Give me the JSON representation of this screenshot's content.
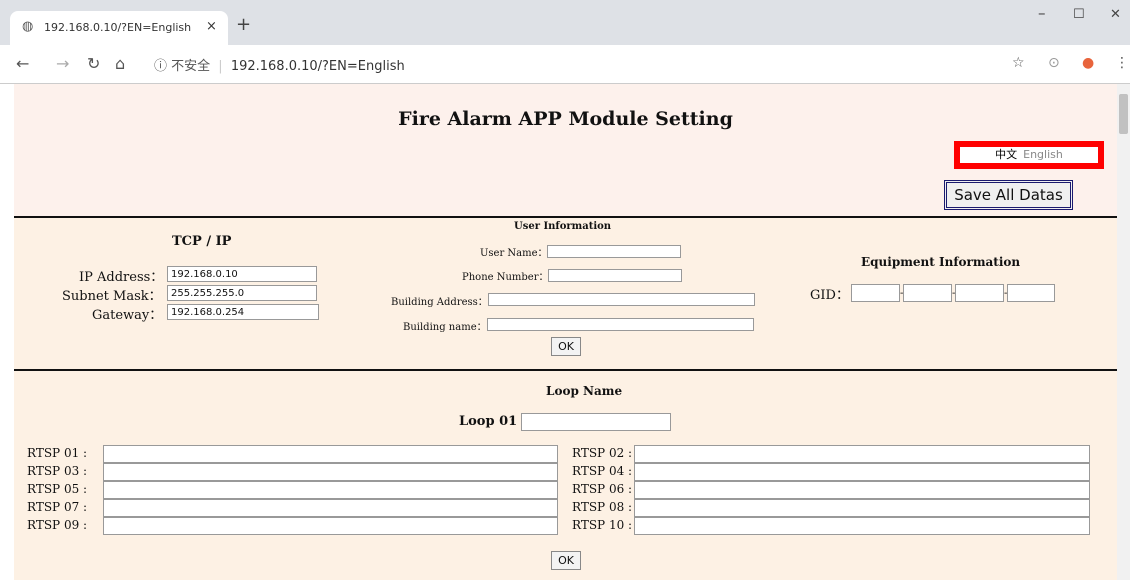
{
  "browser": {
    "tab_title": "192.168.0.10/?EN=English",
    "tab_close": "×",
    "new_tab": "+",
    "minimize": "–",
    "maximize": "☐",
    "window_close": "✕",
    "address_security": "ⓘ 不安全",
    "address_url": "192.168.0.10/?EN=English"
  },
  "page": {
    "title": "Fire Alarm APP Module Setting",
    "lang_chinese": "中文",
    "lang_english": "English",
    "save_button": "Save All Datas"
  },
  "tcpip": {
    "heading": "TCP / IP",
    "ip_label": "IP Address：",
    "ip_value": "192.168.0.10",
    "mask_label": "Subnet Mask：",
    "mask_value": "255.255.255.0",
    "gateway_label": "Gateway：",
    "gateway_value": "192.168.0.254"
  },
  "user_info": {
    "heading": "User Information",
    "user_name_label": "User Name：",
    "phone_label": "Phone Number：",
    "address_label": "Building Address：",
    "building_name_label": "Building name：",
    "ok": "OK"
  },
  "equipment": {
    "heading": "Equipment Information",
    "gid_label": "GID："
  },
  "loop": {
    "heading": "Loop Name",
    "loop_label": "Loop 01",
    "loop_colon": ":",
    "rtsp_left": [
      "RTSP 01 :",
      "RTSP 03 :",
      "RTSP 05 :",
      "RTSP 07 :",
      "RTSP 09 :"
    ],
    "rtsp_right": [
      "RTSP 02 :",
      "RTSP 04 :",
      "RTSP 06 :",
      "RTSP 08 :",
      "RTSP 10 :"
    ],
    "ok": "OK"
  }
}
